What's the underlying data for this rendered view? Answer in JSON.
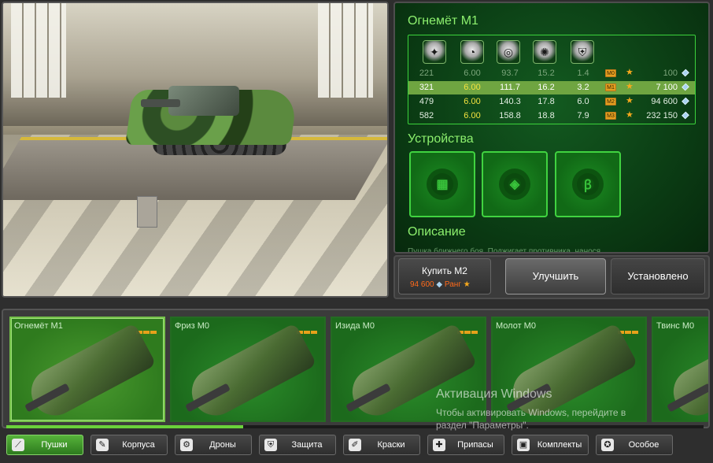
{
  "item": {
    "title": "Огнемёт М1",
    "stats": {
      "rows": [
        {
          "v1": "221",
          "v2": "6.00",
          "v3": "93.7",
          "v4": "15.2",
          "v5": "1.4",
          "rank": "М0",
          "price": "100",
          "state": "dim"
        },
        {
          "v1": "321",
          "v2": "6.00",
          "v3": "111.7",
          "v4": "16.2",
          "v5": "3.2",
          "rank": "М1",
          "price": "7 100",
          "state": "active"
        },
        {
          "v1": "479",
          "v2": "6.00",
          "v3": "140.3",
          "v4": "17.8",
          "v5": "6.0",
          "rank": "М2",
          "price": "94 600",
          "state": "normal"
        },
        {
          "v1": "582",
          "v2": "6.00",
          "v3": "158.8",
          "v4": "18.8",
          "v5": "7.9",
          "rank": "М3",
          "price": "232 150",
          "state": "normal"
        }
      ],
      "icons": [
        "damage-icon",
        "fire-rate-icon",
        "range-icon",
        "heat-icon",
        "protection-icon"
      ]
    },
    "devices_heading": "Устройства",
    "devices": [
      "device-1-icon",
      "device-2-icon",
      "device-3-icon"
    ],
    "description_heading": "Описание",
    "description_text": "Пушка ближнего боя. Поджигает противника, нанося"
  },
  "actions": {
    "buy_label": "Купить М2",
    "buy_price": "94 600",
    "buy_rank_label": "Ранг",
    "upgrade_label": "Улучшить",
    "installed_label": "Установлено"
  },
  "carousel": {
    "items": [
      {
        "name": "Огнемёт М1",
        "level": 1
      },
      {
        "name": "Фриз М0",
        "level": 0
      },
      {
        "name": "Изида М0",
        "level": 0
      },
      {
        "name": "Молот М0",
        "level": 0
      },
      {
        "name": "Твинс М0",
        "level": 0
      }
    ],
    "scroll_progress": 0.34
  },
  "tabs": [
    {
      "label": "Пушки",
      "icon": "cannon-icon",
      "active": true
    },
    {
      "label": "Корпуса",
      "icon": "hull-icon",
      "active": false
    },
    {
      "label": "Дроны",
      "icon": "drone-icon",
      "active": false
    },
    {
      "label": "Защита",
      "icon": "shield-icon",
      "active": false
    },
    {
      "label": "Краски",
      "icon": "paint-icon",
      "active": false
    },
    {
      "label": "Припасы",
      "icon": "supplies-icon",
      "active": false
    },
    {
      "label": "Комплекты",
      "icon": "kit-icon",
      "active": false
    },
    {
      "label": "Особое",
      "icon": "special-icon",
      "active": false
    }
  ],
  "watermark": {
    "line1": "Активация Windows",
    "line2": "Чтобы активировать Windows, перейдите в",
    "line3": "раздел \"Параметры\"."
  },
  "colors": {
    "accent_green": "#8df06e",
    "active_row": "#6fa541",
    "price_orange": "#ff6a1a"
  }
}
